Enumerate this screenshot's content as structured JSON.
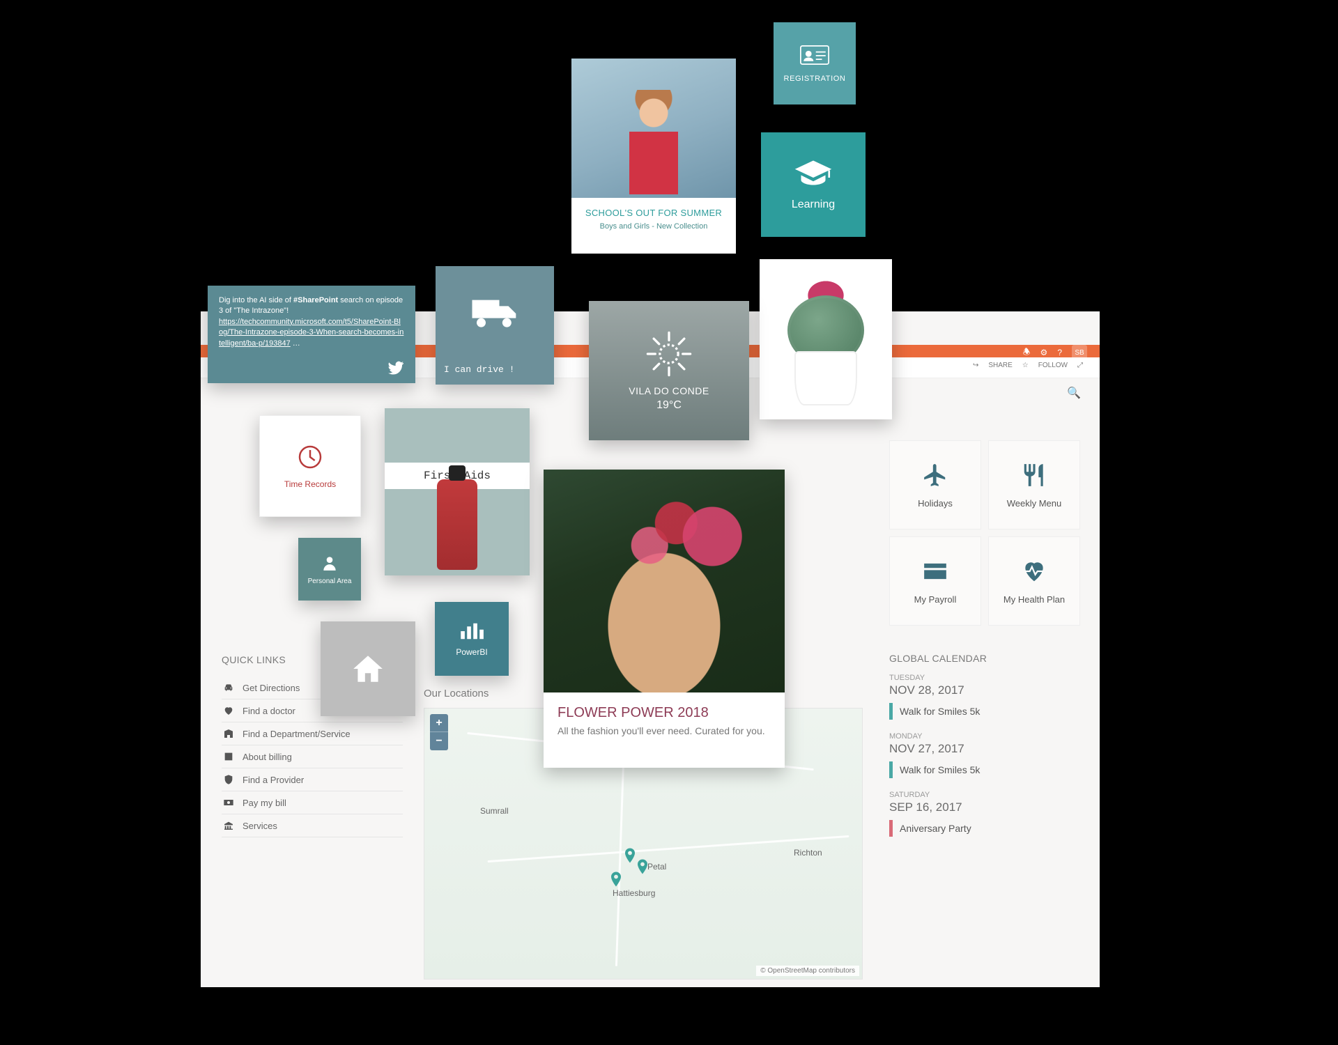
{
  "tiles": {
    "registration": {
      "label": "REGISTRATION"
    },
    "learning": {
      "label": "Learning"
    },
    "school": {
      "title": "SCHOOL'S OUT FOR SUMMER",
      "subtitle": "Boys and Girls - New Collection"
    },
    "twitter": {
      "text_prefix": "Dig into the AI side of ",
      "hashtag": "#SharePoint",
      "text_mid": " search on episode 3 of \"The Intrazone\"!",
      "link": "https://techcommunity.microsoft.com/t5/SharePoint-Blog/The-Intrazone-episode-3-When-search-becomes-intelligent/ba-p/193847",
      "ellipsis": " …"
    },
    "truck": {
      "label": "I can drive !"
    },
    "weather": {
      "city": "VILA DO CONDE",
      "temp": "19°C"
    },
    "time_records": {
      "label": "Time Records"
    },
    "first_aids": {
      "label": "First Aids"
    },
    "personal_area": {
      "label": "Personal Area"
    },
    "powerbi": {
      "label": "PowerBI"
    },
    "flower": {
      "title": "FLOWER POWER 2018",
      "subtitle": "All the fashion you'll ever need. Curated for you."
    }
  },
  "panel": {
    "top_right": {
      "share": "SHARE",
      "follow": "FOLLOW",
      "user_badge": "SB"
    },
    "action_tiles": [
      {
        "icon": "plane",
        "label": "Holidays"
      },
      {
        "icon": "cutlery",
        "label": "Weekly Menu"
      },
      {
        "icon": "card",
        "label": "My Payroll"
      },
      {
        "icon": "heart",
        "label": "My Health Plan"
      }
    ],
    "calendar": {
      "heading": "GLOBAL CALENDAR",
      "items": [
        {
          "day": "TUESDAY",
          "date": "NOV 28, 2017",
          "event": "Walk for Smiles 5k",
          "color": "teal"
        },
        {
          "day": "MONDAY",
          "date": "NOV 27, 2017",
          "event": "Walk for Smiles 5k",
          "color": "teal"
        },
        {
          "day": "SATURDAY",
          "date": "SEP 16, 2017",
          "event": "Aniversary Party",
          "color": "red"
        }
      ]
    },
    "quicklinks": {
      "heading": "QUICK LINKS",
      "items": [
        {
          "icon": "car",
          "label": "Get Directions"
        },
        {
          "icon": "heart",
          "label": "Find a doctor"
        },
        {
          "icon": "building",
          "label": "Find a Department/Service"
        },
        {
          "icon": "info",
          "label": "About billing"
        },
        {
          "icon": "shield",
          "label": "Find a Provider"
        },
        {
          "icon": "money",
          "label": "Pay my bill"
        },
        {
          "icon": "bank",
          "label": "Services"
        }
      ]
    },
    "locations": {
      "heading": "Our Locations",
      "labels": {
        "sumrall": "Sumrall",
        "petal": "Petal",
        "hattiesburg": "Hattiesburg",
        "richton": "Richton"
      },
      "credit": "© OpenStreetMap contributors"
    }
  }
}
